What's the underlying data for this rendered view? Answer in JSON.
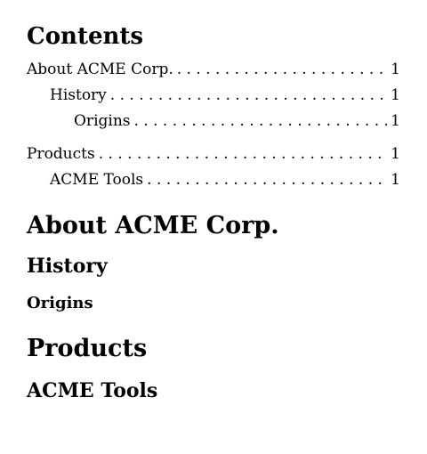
{
  "toc": {
    "title": "Contents",
    "groups": [
      {
        "entries": [
          {
            "label": "About ACME Corp.",
            "page": "1"
          },
          {
            "label": "History",
            "page": "1"
          },
          {
            "label": "Origins",
            "page": "1"
          }
        ]
      },
      {
        "entries": [
          {
            "label": "Products",
            "page": "1"
          },
          {
            "label": "ACME Tools",
            "page": "1"
          }
        ]
      }
    ]
  },
  "sections": {
    "about": "About ACME Corp.",
    "history": "History",
    "origins": "Origins",
    "products": "Products",
    "tools": "ACME Tools"
  }
}
